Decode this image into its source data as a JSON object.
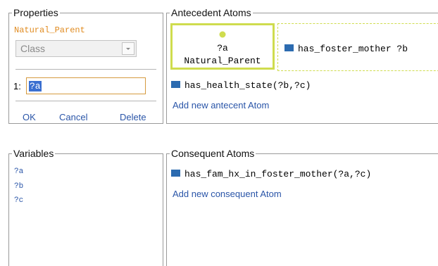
{
  "properties": {
    "title": "Properties",
    "entity_name": "Natural_Parent",
    "type_select": {
      "value": "Class"
    },
    "arg_label": "1:",
    "arg_value": "?a",
    "buttons": {
      "ok": "OK",
      "cancel": "Cancel",
      "delete": "Delete"
    }
  },
  "antecedent": {
    "title": "Antecedent Atoms",
    "selected_atom": {
      "variable": "?a",
      "class_name": "Natural_Parent"
    },
    "atoms": [
      "has_foster_mother ?b",
      "has_health_state(?b,?c)"
    ],
    "add_link": "Add new antecent Atom"
  },
  "variables": {
    "title": "Variables",
    "items": [
      "?a",
      "?b",
      "?c"
    ]
  },
  "consequent": {
    "title": "Consequent Atoms",
    "atoms": [
      "has_fam_hx_in_foster_mother(?a,?c)"
    ],
    "add_link": "Add new consequent Atom"
  },
  "colors": {
    "accent_orange": "#e08a1e",
    "link_blue": "#2a55a8",
    "atom_blue": "#2c6bb0",
    "highlight_green": "#cfdc4e"
  }
}
